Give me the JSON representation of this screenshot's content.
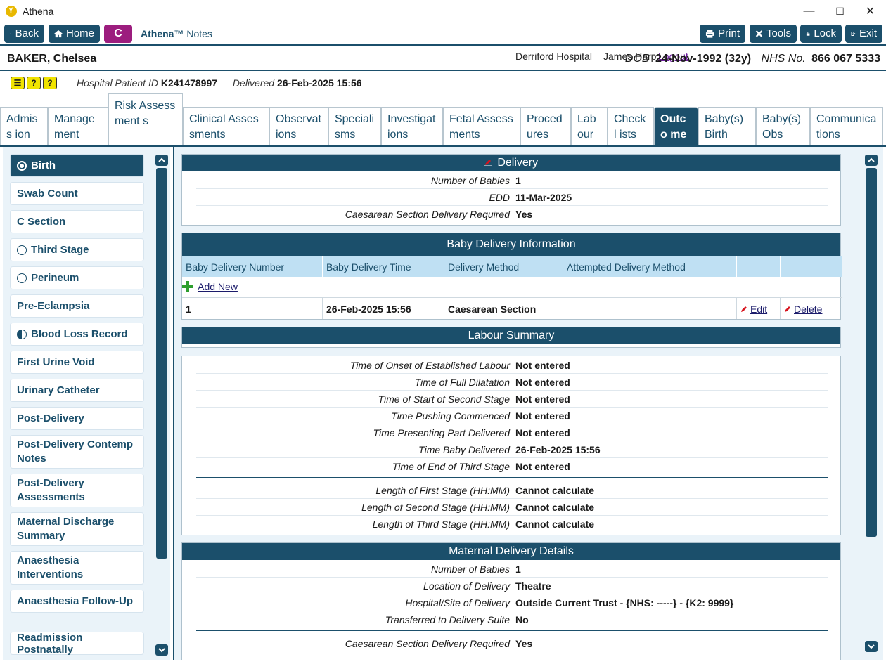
{
  "window": {
    "title": "Athena",
    "minimize": "—",
    "maximize": "☐",
    "close": "✕"
  },
  "toolbar": {
    "back": "Back",
    "home": "Home",
    "c": "C",
    "brand_name": "Athena™",
    "brand_suffix": "Notes",
    "hospital": "Derriford Hospital",
    "user": "James Harp",
    "logout": "Logout",
    "print": "Print",
    "tools": "Tools",
    "lock": "Lock",
    "exit": "Exit"
  },
  "patient": {
    "name": "BAKER, Chelsea",
    "dob_label": "DOB",
    "dob": "24-Nov-1992 (32y)",
    "nhs_label": "NHS No.",
    "nhs": "866 067 5333"
  },
  "info": {
    "hpid_label": "Hospital Patient ID",
    "hpid": "K241478997",
    "delivered_label": "Delivered",
    "delivered": "26-Feb-2025 15:56"
  },
  "tabs": [
    "Admiss ion",
    "Manage ment",
    "Risk Assessment s",
    "Clinical Assessments",
    "Observat ions",
    "Speciali sms",
    "Investigat ions",
    "Fetal Assessments",
    "Proced ures",
    "Lab our",
    "Checkl ists",
    "Outco me",
    "Baby(s) Birth",
    "Baby(s) Obs",
    "Communica tions"
  ],
  "nav": [
    "Birth",
    "Swab Count",
    "C Section",
    "Third Stage",
    "Perineum",
    "Pre-Eclampsia",
    "Blood Loss Record",
    "First Urine Void",
    "Urinary Catheter",
    "Post-Delivery",
    "Post-Delivery Contemp Notes",
    "Post-Delivery Assessments",
    "Maternal Discharge Summary",
    "Anaesthesia Interventions",
    "Anaesthesia Follow-Up",
    "Readmission Postnatally"
  ],
  "delivery": {
    "title": "Delivery",
    "rows": [
      {
        "label": "Number of Babies",
        "value": "1"
      },
      {
        "label": "EDD",
        "value": "11-Mar-2025"
      },
      {
        "label": "Caesarean Section Delivery Required",
        "value": "Yes"
      }
    ]
  },
  "baby_delivery": {
    "title": "Baby Delivery Information",
    "headers": [
      "Baby Delivery Number",
      "Baby Delivery Time",
      "Delivery Method",
      "Attempted Delivery Method",
      "",
      ""
    ],
    "add_new": "Add New",
    "row": {
      "number": "1",
      "time": "26-Feb-2025 15:56",
      "method": "Caesarean Section",
      "attempted": "",
      "edit": "Edit",
      "delete": "Delete"
    }
  },
  "labour_summary": {
    "title": "Labour Summary"
  },
  "labour_details": {
    "rows": [
      {
        "label": "Time of Onset of Established Labour",
        "value": "Not entered"
      },
      {
        "label": "Time of Full Dilatation",
        "value": "Not entered"
      },
      {
        "label": "Time of Start of Second Stage",
        "value": "Not entered"
      },
      {
        "label": "Time Pushing Commenced",
        "value": "Not entered"
      },
      {
        "label": "Time Presenting Part Delivered",
        "value": "Not entered"
      },
      {
        "label": "Time Baby Delivered",
        "value": "26-Feb-2025 15:56"
      },
      {
        "label": "Time of End of Third Stage",
        "value": "Not entered"
      },
      {
        "label": "Length of First Stage (HH:MM)",
        "value": "Cannot calculate"
      },
      {
        "label": "Length of Second Stage (HH:MM)",
        "value": "Cannot calculate"
      },
      {
        "label": "Length of Third Stage (HH:MM)",
        "value": "Cannot calculate"
      }
    ]
  },
  "maternal": {
    "title": "Maternal Delivery Details",
    "rows": [
      {
        "label": "Number of Babies",
        "value": "1"
      },
      {
        "label": "Location of Delivery",
        "value": "Theatre"
      },
      {
        "label": "Hospital/Site of Delivery",
        "value": "Outside Current Trust - {NHS: -----} - {K2: 9999}"
      },
      {
        "label": "Transferred to Delivery Suite",
        "value": "No"
      },
      {
        "label": "Caesarean Section Delivery Required",
        "value": "Yes"
      }
    ]
  },
  "colors": {
    "primary": "#1b4f6b",
    "accent_c": "#9c1d7e",
    "panel_bg": "#eaf3f9",
    "header_row": "#bfe0f3"
  }
}
